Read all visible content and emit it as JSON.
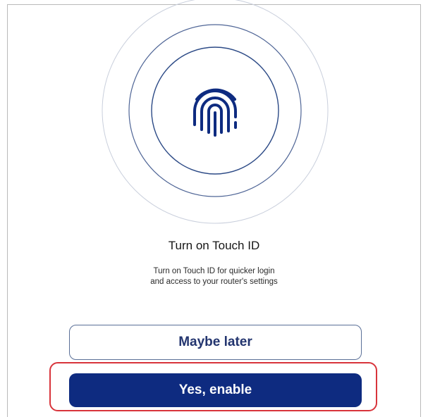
{
  "screen": {
    "title": "Turn on Touch ID",
    "description_line1": "Turn on Touch ID for quicker login",
    "description_line2": "and access to your router's settings"
  },
  "buttons": {
    "maybe_later": "Maybe later",
    "yes_enable": "Yes, enable"
  },
  "icons": {
    "fingerprint": "fingerprint-icon"
  },
  "colors": {
    "primary": "#0e2b80",
    "outline_text": "#23356f",
    "highlight": "#d8343b",
    "ring": "#2c4a86"
  }
}
